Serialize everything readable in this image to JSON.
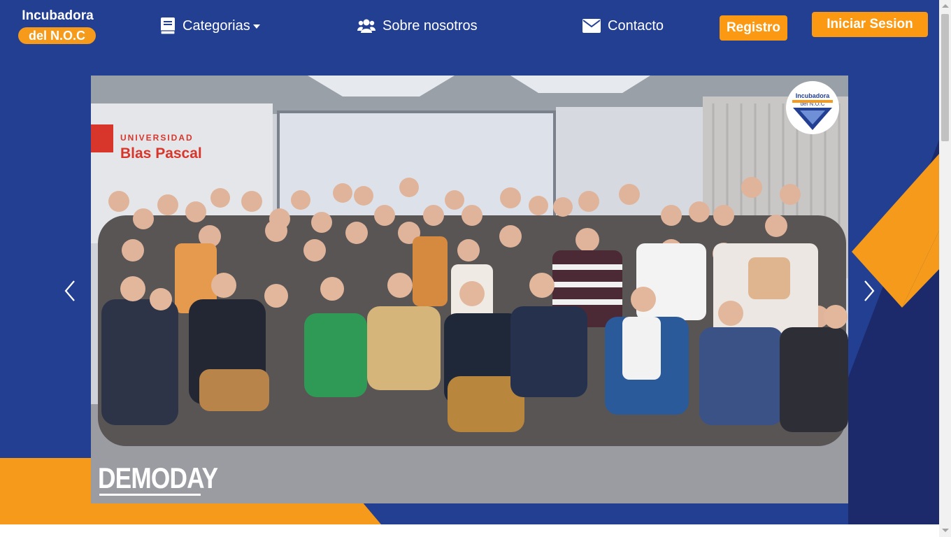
{
  "brand": {
    "line1": "Incubadora",
    "line2": "del N.O.C"
  },
  "nav": {
    "categories": "Categorias",
    "about": "Sobre nosotros",
    "contact": "Contacto",
    "register": "Registro",
    "login": "Iniciar Sesion"
  },
  "hero": {
    "banner_label": "DEMODAY",
    "photo_sign_top": "UNIVERSIDAD",
    "photo_sign_bottom": "Blas Pascal",
    "badge_line1": "Incubadora",
    "badge_line2": "del N.O.C"
  },
  "icons": {
    "categories": "book-icon",
    "about": "users-icon",
    "contact": "envelope-icon",
    "prev": "chevron-left-icon",
    "next": "chevron-right-icon"
  },
  "colors": {
    "background": "#233f92",
    "accent": "#f59a1b",
    "dark_panel": "#1c2a6b",
    "white": "#ffffff"
  }
}
